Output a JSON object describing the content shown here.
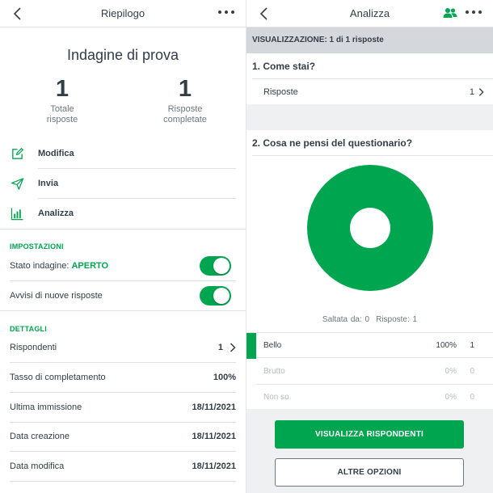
{
  "left": {
    "header": {
      "title": "Riepilogo"
    },
    "survey_title": "Indagine di prova",
    "stats": [
      {
        "value": "1",
        "label_line1": "Totale",
        "label_line2": "risposte"
      },
      {
        "value": "1",
        "label_line1": "Risposte",
        "label_line2": "completate"
      }
    ],
    "actions": [
      {
        "label": "Modifica",
        "icon": "edit-icon"
      },
      {
        "label": "Invia",
        "icon": "send-icon"
      },
      {
        "label": "Analizza",
        "icon": "bar-chart-icon"
      }
    ],
    "settings": {
      "heading": "IMPOSTAZIONI",
      "status_label": "Stato indagine: ",
      "status_value": "APERTO",
      "notify_label": "Avvisi di nuove risposte",
      "status_on": true,
      "notify_on": true
    },
    "details": {
      "heading": "DETTAGLI",
      "rows": [
        {
          "label": "Rispondenti",
          "value": "1"
        },
        {
          "label": "Tasso di completamento",
          "value": "100%"
        },
        {
          "label": "Ultima immissione",
          "value": "18/11/2021"
        },
        {
          "label": "Data creazione",
          "value": "18/11/2021"
        },
        {
          "label": "Data modifica",
          "value": "18/11/2021"
        }
      ]
    }
  },
  "right": {
    "header": {
      "title": "Analizza"
    },
    "view_label": "VISUALIZZAZIONE: 1 di 1 risposte",
    "q1": {
      "title": "1. Come stai?",
      "responses_label": "Risposte",
      "responses_value": "1"
    },
    "q2": {
      "title": "2. Cosa ne pensi del questionario?",
      "skipped": "Saltata da: 0",
      "answered": "Risposte: 1",
      "answers": [
        {
          "label": "Bello",
          "percent": "100%",
          "count": "1",
          "share": 1.0
        },
        {
          "label": "Brutto",
          "percent": "0%",
          "count": "0",
          "share": 0.0
        },
        {
          "label": "Non so",
          "percent": "0%",
          "count": "0",
          "share": 0.0
        }
      ]
    },
    "buttons": {
      "primary": "VISUALIZZA RISPONDENTI",
      "secondary": "ALTRE OPZIONI"
    }
  },
  "colors": {
    "accent": "#00a550",
    "text": "#333e48",
    "muted": "#6b787f",
    "bar_bg": "#d4d8dc"
  }
}
